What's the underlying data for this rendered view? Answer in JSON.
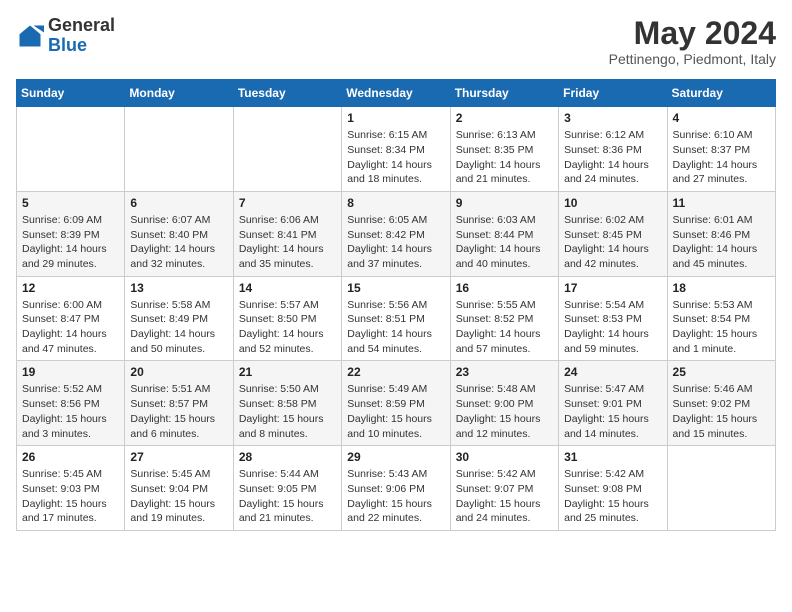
{
  "header": {
    "logo_general": "General",
    "logo_blue": "Blue",
    "month_title": "May 2024",
    "subtitle": "Pettinengo, Piedmont, Italy"
  },
  "weekdays": [
    "Sunday",
    "Monday",
    "Tuesday",
    "Wednesday",
    "Thursday",
    "Friday",
    "Saturday"
  ],
  "weeks": [
    [
      {
        "day": "",
        "info": ""
      },
      {
        "day": "",
        "info": ""
      },
      {
        "day": "",
        "info": ""
      },
      {
        "day": "1",
        "info": "Sunrise: 6:15 AM\nSunset: 8:34 PM\nDaylight: 14 hours\nand 18 minutes."
      },
      {
        "day": "2",
        "info": "Sunrise: 6:13 AM\nSunset: 8:35 PM\nDaylight: 14 hours\nand 21 minutes."
      },
      {
        "day": "3",
        "info": "Sunrise: 6:12 AM\nSunset: 8:36 PM\nDaylight: 14 hours\nand 24 minutes."
      },
      {
        "day": "4",
        "info": "Sunrise: 6:10 AM\nSunset: 8:37 PM\nDaylight: 14 hours\nand 27 minutes."
      }
    ],
    [
      {
        "day": "5",
        "info": "Sunrise: 6:09 AM\nSunset: 8:39 PM\nDaylight: 14 hours\nand 29 minutes."
      },
      {
        "day": "6",
        "info": "Sunrise: 6:07 AM\nSunset: 8:40 PM\nDaylight: 14 hours\nand 32 minutes."
      },
      {
        "day": "7",
        "info": "Sunrise: 6:06 AM\nSunset: 8:41 PM\nDaylight: 14 hours\nand 35 minutes."
      },
      {
        "day": "8",
        "info": "Sunrise: 6:05 AM\nSunset: 8:42 PM\nDaylight: 14 hours\nand 37 minutes."
      },
      {
        "day": "9",
        "info": "Sunrise: 6:03 AM\nSunset: 8:44 PM\nDaylight: 14 hours\nand 40 minutes."
      },
      {
        "day": "10",
        "info": "Sunrise: 6:02 AM\nSunset: 8:45 PM\nDaylight: 14 hours\nand 42 minutes."
      },
      {
        "day": "11",
        "info": "Sunrise: 6:01 AM\nSunset: 8:46 PM\nDaylight: 14 hours\nand 45 minutes."
      }
    ],
    [
      {
        "day": "12",
        "info": "Sunrise: 6:00 AM\nSunset: 8:47 PM\nDaylight: 14 hours\nand 47 minutes."
      },
      {
        "day": "13",
        "info": "Sunrise: 5:58 AM\nSunset: 8:49 PM\nDaylight: 14 hours\nand 50 minutes."
      },
      {
        "day": "14",
        "info": "Sunrise: 5:57 AM\nSunset: 8:50 PM\nDaylight: 14 hours\nand 52 minutes."
      },
      {
        "day": "15",
        "info": "Sunrise: 5:56 AM\nSunset: 8:51 PM\nDaylight: 14 hours\nand 54 minutes."
      },
      {
        "day": "16",
        "info": "Sunrise: 5:55 AM\nSunset: 8:52 PM\nDaylight: 14 hours\nand 57 minutes."
      },
      {
        "day": "17",
        "info": "Sunrise: 5:54 AM\nSunset: 8:53 PM\nDaylight: 14 hours\nand 59 minutes."
      },
      {
        "day": "18",
        "info": "Sunrise: 5:53 AM\nSunset: 8:54 PM\nDaylight: 15 hours\nand 1 minute."
      }
    ],
    [
      {
        "day": "19",
        "info": "Sunrise: 5:52 AM\nSunset: 8:56 PM\nDaylight: 15 hours\nand 3 minutes."
      },
      {
        "day": "20",
        "info": "Sunrise: 5:51 AM\nSunset: 8:57 PM\nDaylight: 15 hours\nand 6 minutes."
      },
      {
        "day": "21",
        "info": "Sunrise: 5:50 AM\nSunset: 8:58 PM\nDaylight: 15 hours\nand 8 minutes."
      },
      {
        "day": "22",
        "info": "Sunrise: 5:49 AM\nSunset: 8:59 PM\nDaylight: 15 hours\nand 10 minutes."
      },
      {
        "day": "23",
        "info": "Sunrise: 5:48 AM\nSunset: 9:00 PM\nDaylight: 15 hours\nand 12 minutes."
      },
      {
        "day": "24",
        "info": "Sunrise: 5:47 AM\nSunset: 9:01 PM\nDaylight: 15 hours\nand 14 minutes."
      },
      {
        "day": "25",
        "info": "Sunrise: 5:46 AM\nSunset: 9:02 PM\nDaylight: 15 hours\nand 15 minutes."
      }
    ],
    [
      {
        "day": "26",
        "info": "Sunrise: 5:45 AM\nSunset: 9:03 PM\nDaylight: 15 hours\nand 17 minutes."
      },
      {
        "day": "27",
        "info": "Sunrise: 5:45 AM\nSunset: 9:04 PM\nDaylight: 15 hours\nand 19 minutes."
      },
      {
        "day": "28",
        "info": "Sunrise: 5:44 AM\nSunset: 9:05 PM\nDaylight: 15 hours\nand 21 minutes."
      },
      {
        "day": "29",
        "info": "Sunrise: 5:43 AM\nSunset: 9:06 PM\nDaylight: 15 hours\nand 22 minutes."
      },
      {
        "day": "30",
        "info": "Sunrise: 5:42 AM\nSunset: 9:07 PM\nDaylight: 15 hours\nand 24 minutes."
      },
      {
        "day": "31",
        "info": "Sunrise: 5:42 AM\nSunset: 9:08 PM\nDaylight: 15 hours\nand 25 minutes."
      },
      {
        "day": "",
        "info": ""
      }
    ]
  ]
}
